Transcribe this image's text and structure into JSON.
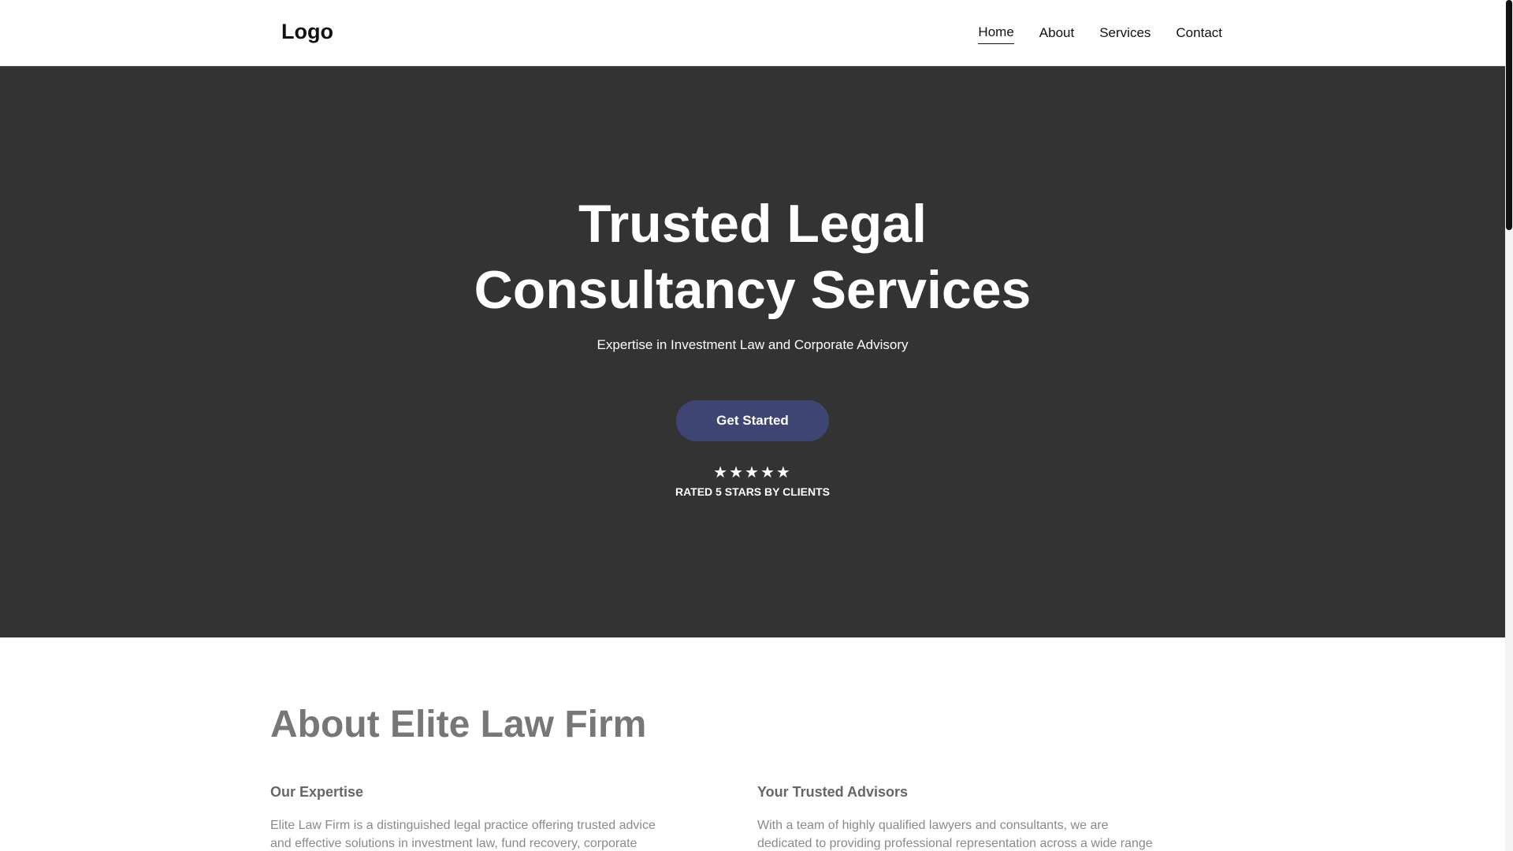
{
  "header": {
    "logo": "Logo",
    "nav": [
      {
        "label": "Home",
        "active": true
      },
      {
        "label": "About",
        "active": false
      },
      {
        "label": "Services",
        "active": false
      },
      {
        "label": "Contact",
        "active": false
      }
    ]
  },
  "hero": {
    "title_line1": "Trusted Legal",
    "title_line2": "Consultancy Services",
    "subtitle": "Expertise in Investment Law and Corporate Advisory",
    "cta_label": "Get Started",
    "stars": "★★★★★",
    "rating": {
      "value": 5,
      "max": 5
    },
    "rating_text": "RATED 5 STARS BY CLIENTS",
    "background_color": "#333333",
    "button_color": "#3f4572"
  },
  "about": {
    "title": "About Elite Law Firm",
    "columns": [
      {
        "heading": "Our Expertise",
        "text": "Elite Law Firm is a distinguished legal practice offering trusted advice and effective solutions in investment law, fund recovery, corporate"
      },
      {
        "heading": "Your Trusted Advisors",
        "text": "With a team of highly qualified lawyers and consultants, we are dedicated to providing professional representation across a wide range"
      }
    ]
  }
}
